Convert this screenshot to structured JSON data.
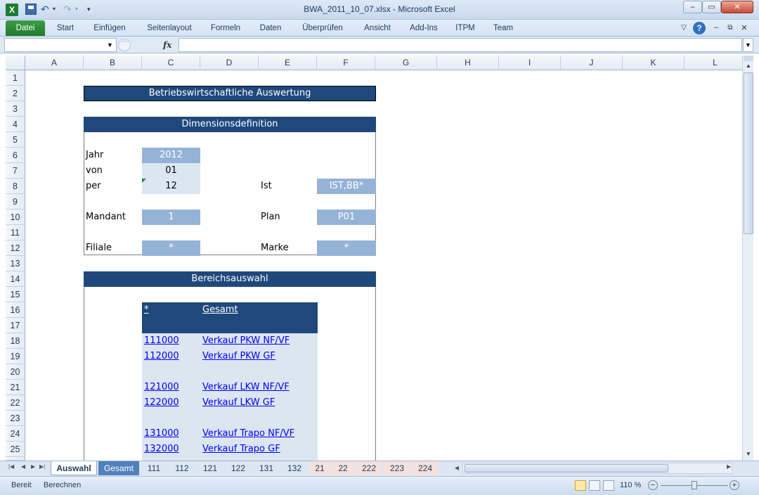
{
  "window": {
    "title": "BWA_2011_10_07.xlsx - Microsoft Excel",
    "minimize": "–",
    "maximize": "▭",
    "close": "✕"
  },
  "ribbon": {
    "tabs": [
      "Datei",
      "Start",
      "Einfügen",
      "Seitenlayout",
      "Formeln",
      "Daten",
      "Überprüfen",
      "Ansicht",
      "Add-Ins",
      "ITPM",
      "Team"
    ]
  },
  "formula_bar": {
    "name_box": "",
    "fx": "fx",
    "content": ""
  },
  "columns": [
    "A",
    "B",
    "C",
    "D",
    "E",
    "F",
    "G",
    "H",
    "I",
    "J",
    "K",
    "L"
  ],
  "rows": [
    "1",
    "2",
    "3",
    "4",
    "5",
    "6",
    "7",
    "8",
    "9",
    "10",
    "11",
    "12",
    "13",
    "14",
    "15",
    "16",
    "17",
    "18",
    "19",
    "20",
    "21",
    "22",
    "23",
    "24",
    "25"
  ],
  "sheet": {
    "title": "Betriebswirtschaftliche Auswertung",
    "dimensions": {
      "header": "Dimensionsdefinition",
      "jahr_label": "Jahr",
      "jahr_value": "2012",
      "von_label": "von",
      "von_value": "01",
      "per_label": "per",
      "per_value": "12",
      "mandant_label": "Mandant",
      "mandant_value": "1",
      "filiale_label": "Filiale",
      "filiale_value": "*",
      "ist_label": "Ist",
      "ist_value": "IST,BB*",
      "plan_label": "Plan",
      "plan_value": "P01",
      "marke_label": "Marke",
      "marke_value": "*"
    },
    "bereich": {
      "header": "Bereichsauswahl",
      "all_code": "*",
      "all_label": "Gesamt",
      "items": [
        {
          "code": "111000",
          "label": "Verkauf PKW NF/VF"
        },
        {
          "code": "112000",
          "label": "Verkauf PKW GF"
        },
        {
          "code": "121000",
          "label": "Verkauf LKW NF/VF"
        },
        {
          "code": "122000",
          "label": "Verkauf LKW GF"
        },
        {
          "code": "131000",
          "label": "Verkauf Trapo NF/VF"
        },
        {
          "code": "132000",
          "label": "Verkauf Trapo GF"
        }
      ]
    }
  },
  "sheet_tabs": [
    "Auswahl",
    "Gesamt",
    "111",
    "112",
    "121",
    "122",
    "131",
    "132",
    "21",
    "22",
    "222",
    "223",
    "224"
  ],
  "status": {
    "ready": "Bereit",
    "calc": "Berechnen",
    "zoom": "110 %"
  },
  "colors": {
    "accent_dark": "#1f497d",
    "input_blue": "#95b3d7",
    "light_blue": "#dce6f1",
    "excel_green": "#217a2c"
  }
}
